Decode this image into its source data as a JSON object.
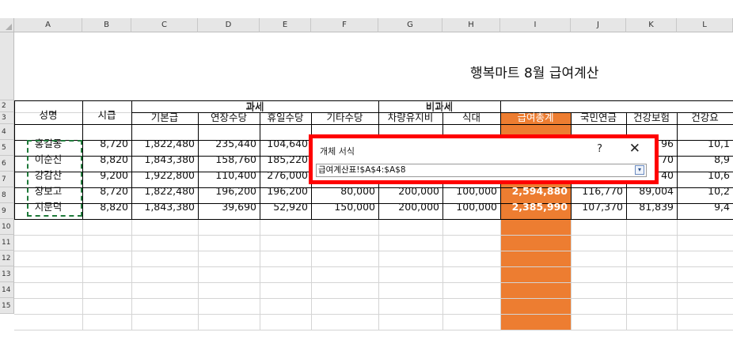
{
  "columns": [
    "A",
    "B",
    "C",
    "D",
    "E",
    "F",
    "G",
    "H",
    "I",
    "J",
    "K",
    "L"
  ],
  "row_numbers": [
    "2",
    "3",
    "4",
    "5",
    "6",
    "7",
    "8",
    "9",
    "10",
    "11",
    "12",
    "13",
    "14",
    "15"
  ],
  "sheet_title": "행복마트 8월 급여계산",
  "headers": {
    "name": "성명",
    "wage": "시급",
    "taxable": "과세",
    "nontaxable": "비과세",
    "sub": [
      "기본급",
      "연장수당",
      "휴일수당",
      "기타수당",
      "차량유지비",
      "식대",
      "급여총계",
      "국민연금",
      "건강보험",
      "건강요"
    ]
  },
  "rows": [
    {
      "name": "홍길동",
      "wage": "8,720",
      "base": "1,822,480",
      "overtime": "235,440",
      "holiday": "104,640",
      "other": "",
      "car": "",
      "meal": "",
      "total": "",
      "pension": "",
      "health": "96",
      "care": "10,1"
    },
    {
      "name": "이순신",
      "wage": "8,820",
      "base": "1,843,380",
      "overtime": "158,760",
      "holiday": "185,220",
      "other": "",
      "car": "",
      "meal": "",
      "total": "",
      "pension": "",
      "health": "70",
      "care": "8,9"
    },
    {
      "name": "강감찬",
      "wage": "9,200",
      "base": "1,922,800",
      "overtime": "110,400",
      "holiday": "276,000",
      "other": "",
      "car": "",
      "meal": "",
      "total": "",
      "pension": "",
      "health": "40",
      "care": "10,6"
    },
    {
      "name": "장보고",
      "wage": "8,720",
      "base": "1,822,480",
      "overtime": "196,200",
      "holiday": "196,200",
      "other": "80,000",
      "car": "200,000",
      "meal": "100,000",
      "total": "2,594,880",
      "pension": "116,770",
      "health": "89,004",
      "care": "10,2"
    },
    {
      "name": "지문덕",
      "wage": "8,820",
      "base": "1,843,380",
      "overtime": "39,690",
      "holiday": "52,920",
      "other": "150,000",
      "car": "200,000",
      "meal": "100,000",
      "total": "2,385,990",
      "pension": "107,370",
      "health": "81,839",
      "care": "9,4"
    }
  ],
  "dialog": {
    "title": "개체 서식",
    "help": "?",
    "close": "✕",
    "reference": "급여계산표!$A$4:$A$8",
    "collapse_icon": "▾"
  },
  "colors": {
    "total_column": "#ed7d31",
    "dialog_border": "#ff0000",
    "copy_marquee": "#1f7a3a"
  }
}
